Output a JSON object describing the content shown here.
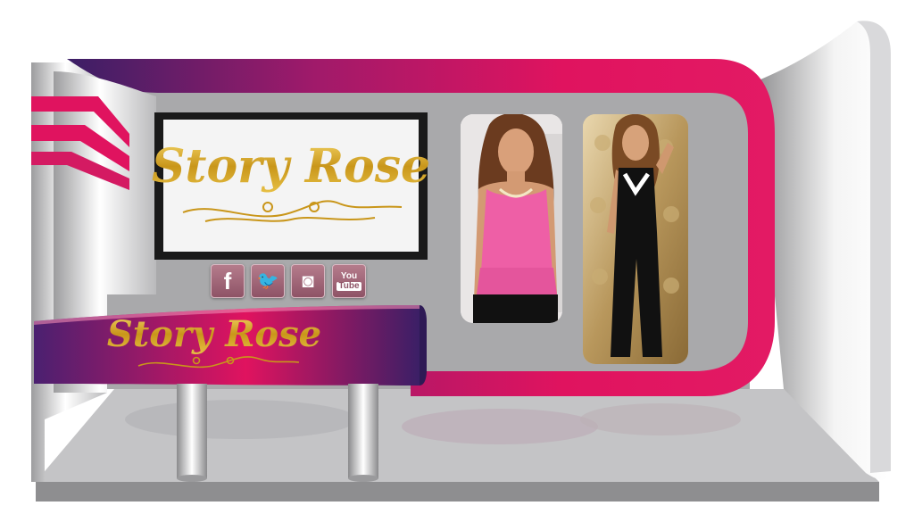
{
  "booth": {
    "brand_name": "Story Rose",
    "colors": {
      "magenta": "#e0135f",
      "purple": "#3b1f66",
      "gold": "#d8b02a",
      "panel_gray": "#a9a9ab",
      "floor_gray": "#c4c4c6"
    }
  },
  "screen": {
    "logo_text": "Story Rose"
  },
  "counter": {
    "logo_text": "Story Rose"
  },
  "social": [
    {
      "id": "facebook",
      "icon": "facebook-icon",
      "glyph": "f"
    },
    {
      "id": "twitter",
      "icon": "twitter-icon",
      "glyph": "🐦"
    },
    {
      "id": "instagram",
      "icon": "instagram-icon",
      "glyph": "◙"
    },
    {
      "id": "youtube",
      "icon": "youtube-icon",
      "glyph_line1": "You",
      "glyph_line2": "Tube"
    }
  ],
  "photos": [
    {
      "id": "model-pink-top",
      "outfit_color": "#ee5fa6"
    },
    {
      "id": "model-black-jumpsuit",
      "outfit_color": "#111111"
    }
  ]
}
